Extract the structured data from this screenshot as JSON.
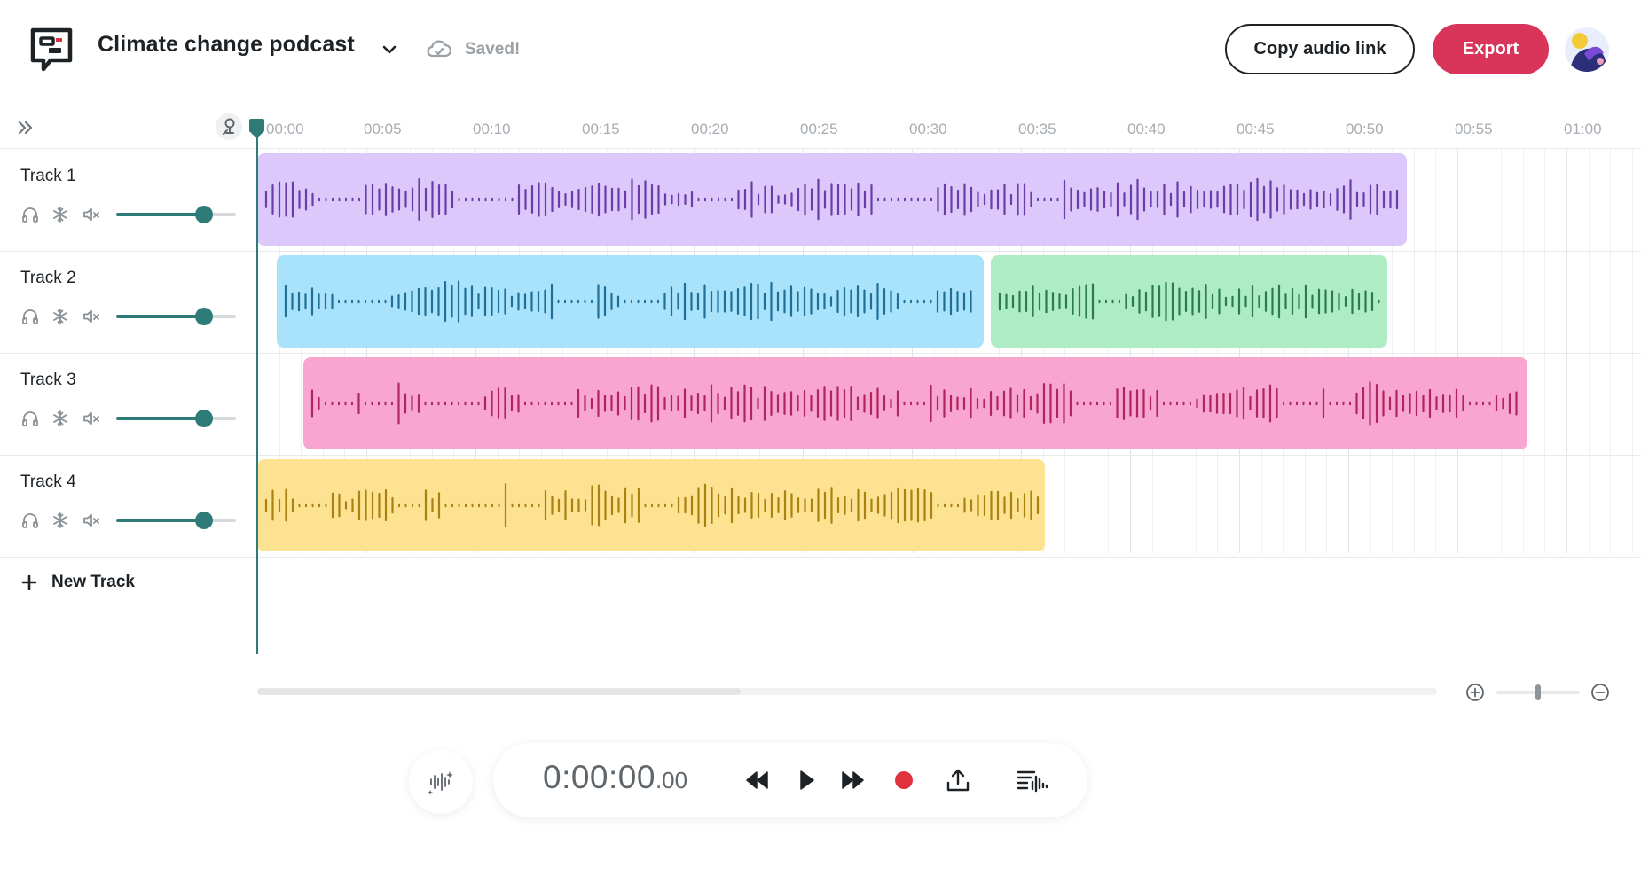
{
  "header": {
    "project_title": "Climate change podcast",
    "save_status": "Saved!",
    "copy_link_label": "Copy audio link",
    "export_label": "Export"
  },
  "colors": {
    "accent_teal": "#2f7b78",
    "export_red": "#d9345a",
    "record_red": "#e0323c"
  },
  "timeline": {
    "ticks": [
      "00:00",
      "00:05",
      "00:10",
      "00:15",
      "00:20",
      "00:25",
      "00:30",
      "00:35",
      "00:40",
      "00:45",
      "00:50",
      "00:55",
      "01:00"
    ],
    "playhead_time": "00:00"
  },
  "tracks": [
    {
      "name": "Track 1",
      "volume": 0.73,
      "clips": [
        {
          "start_s": 0,
          "end_s": 52.7,
          "fill": "#dcc8fb",
          "wave": "#6a3ea6"
        }
      ]
    },
    {
      "name": "Track 2",
      "volume": 0.73,
      "clips": [
        {
          "start_s": 0.9,
          "end_s": 33.3,
          "fill": "#a9e3fb",
          "wave": "#1f6f96"
        },
        {
          "start_s": 33.6,
          "end_s": 51.8,
          "fill": "#aeecc4",
          "wave": "#2b7a52"
        }
      ]
    },
    {
      "name": "Track 3",
      "volume": 0.73,
      "clips": [
        {
          "start_s": 2.1,
          "end_s": 58.2,
          "fill": "#f8a6cf",
          "wave": "#b0245f"
        }
      ]
    },
    {
      "name": "Track 4",
      "volume": 0.73,
      "clips": [
        {
          "start_s": 0,
          "end_s": 36.1,
          "fill": "#fde391",
          "wave": "#a98212"
        }
      ]
    }
  ],
  "new_track_label": "New Track",
  "transport": {
    "time_main": "0:00:00",
    "time_fraction": ".00"
  },
  "icons": {
    "logo": "chat-bubble-logo-icon",
    "title_dropdown": "chevron-down-icon",
    "save": "cloud-icon",
    "expand": "double-chevron-right-icon",
    "snap": "snap-icon",
    "solo": "headphones-icon",
    "freeze": "snowflake-icon",
    "mute": "speaker-mute-icon",
    "add": "plus-icon",
    "zoom_in": "zoom-in-icon",
    "zoom_out": "zoom-out-icon",
    "effects": "sparkle-waveform-icon",
    "rewind": "rewind-icon",
    "play": "play-icon",
    "fast_forward": "fast-forward-icon",
    "record": "record-icon",
    "upload": "upload-icon",
    "script": "script-waveform-icon"
  },
  "scroll": {
    "position": 0,
    "visible_fraction": 0.41
  },
  "zoom": {
    "level": 0.5
  }
}
